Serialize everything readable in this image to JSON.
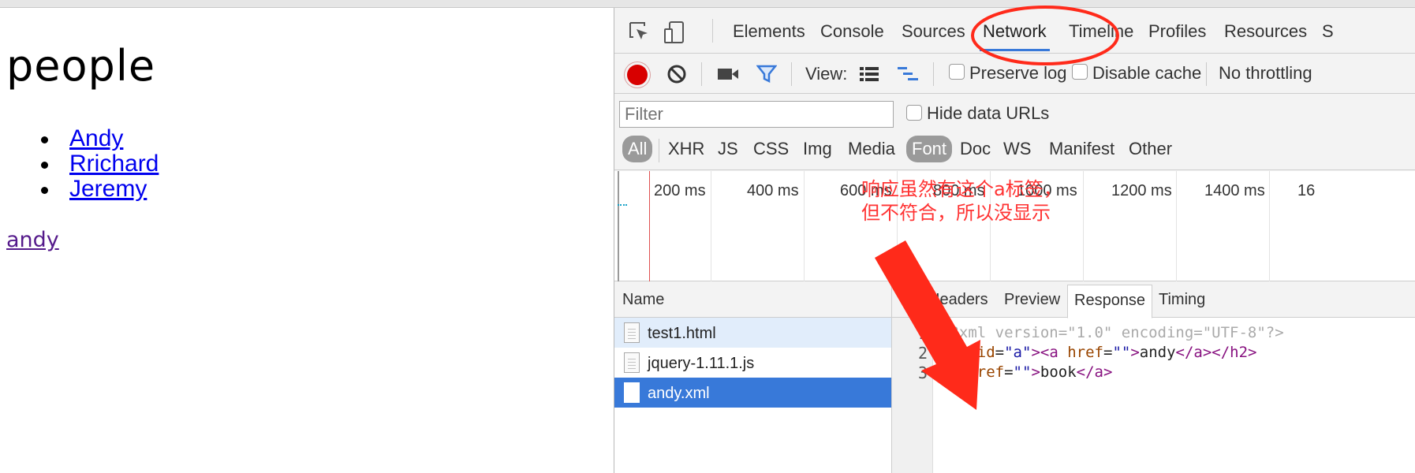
{
  "page": {
    "heading": "people",
    "people": [
      "Andy",
      "Rrichard",
      "Jeremy"
    ],
    "result_link": "andy"
  },
  "devtools": {
    "tabs": [
      "Elements",
      "Console",
      "Sources",
      "Network",
      "Timeline",
      "Profiles",
      "Resources",
      "S"
    ],
    "active_tab": "Network",
    "toolbar": {
      "view_label": "View:",
      "preserve_log": "Preserve log",
      "disable_cache": "Disable cache",
      "throttling": "No throttling"
    },
    "filter": {
      "placeholder": "Filter",
      "hide_data_urls": "Hide data URLs",
      "types": [
        "All",
        "XHR",
        "JS",
        "CSS",
        "Img",
        "Media",
        "Font",
        "Doc",
        "WS",
        "Manifest",
        "Other"
      ]
    },
    "timeline_ticks": [
      "200 ms",
      "400 ms",
      "600 ms",
      "800 ms",
      "1000 ms",
      "1200 ms",
      "1400 ms",
      "16"
    ],
    "requests": {
      "header": "Name",
      "rows": [
        "test1.html",
        "jquery-1.11.1.js",
        "andy.xml"
      ],
      "selected": "andy.xml"
    },
    "detail_tabs": [
      "Headers",
      "Preview",
      "Response",
      "Timing"
    ],
    "active_detail_tab": "Response",
    "response": {
      "line_numbers": [
        "1",
        "2",
        "3"
      ],
      "line1": "<?xml version=\"1.0\" encoding=\"UTF-8\"?>",
      "l2_open_h2": "<h2 ",
      "l2_id_attr": "id",
      "l2_eq1": "=",
      "l2_id_val": "\"a\"",
      "l2_gt1": ">",
      "l2_open_a": "<a ",
      "l2_href": "href",
      "l2_eq2": "=",
      "l2_href_val": "\"\"",
      "l2_gt2": ">",
      "l2_text": "andy",
      "l2_close": "</a></h2>",
      "l3_open_a": "<a ",
      "l3_href": "href",
      "l3_eq": "=",
      "l3_href_val": "\"\"",
      "l3_gt": ">",
      "l3_text": "book",
      "l3_close": "</a>"
    }
  },
  "annotation": {
    "line1": "响应虽然有这个a标签，",
    "line2": "但不符合，所以没显示",
    "color": "#ff2a1a"
  }
}
